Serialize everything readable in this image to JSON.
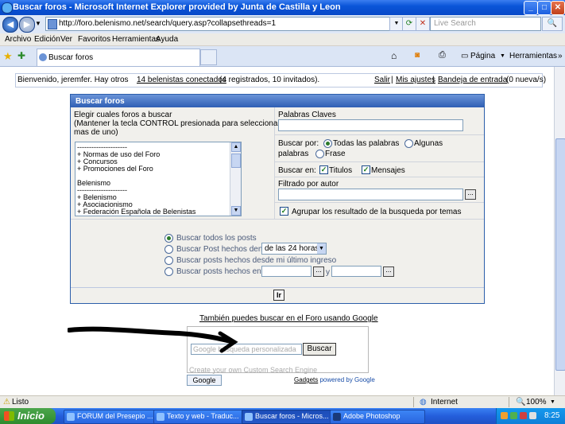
{
  "window": {
    "title": "Buscar foros - Microsoft Internet Explorer provided by Junta de Castilla y Leon",
    "controls": {
      "minimize": "_",
      "maximize": "□",
      "close": "✕"
    }
  },
  "addressbar": {
    "back_icon": "◀",
    "forward_icon": "▶",
    "url": "http://foro.belenismo.net/search/query.asp?collapsethreads=1",
    "refresh_icon": "⟳",
    "stop_icon": "✕",
    "search_placeholder": "Live Search",
    "search_icon": "🔍"
  },
  "menubar": {
    "items": [
      "Archivo",
      "Edición",
      "Ver",
      "Favoritos",
      "Herramientas",
      "Ayuda"
    ]
  },
  "tabbar": {
    "tab_label": "Buscar foros",
    "pagina_label": "Página",
    "herramientas_label": "Herramientas"
  },
  "welcome": {
    "prefix": "Bienvenido, jeremfer. Hay otros ",
    "link": "14 belenistas conectados",
    "suffix": " (4 registrados, 10 invitados).",
    "salir": "Salir",
    "sep1": "|",
    "ajustes": "Mis ajustes",
    "sep2": "|",
    "bandeja": "Bandeja de entrada",
    "bandeja_count": "(0 nueva/s)"
  },
  "panel": {
    "header": "Buscar foros",
    "choose_label_1": "Elegir cuales foros a buscar",
    "choose_label_2": "(Mantener la tecla CONTROL presionada para seleccionar",
    "choose_label_3": "mas de uno)",
    "forum_list": [
      "---------------------",
      "+ Normas de uso del Foro",
      "+ Concursos",
      "+ Promociones del Foro",
      "",
      "Belenismo",
      "---------------------",
      "+ Belenismo",
      "+ Asociacionismo",
      "+ Federación Española de Belenistas"
    ],
    "keywords_label": "Palabras Claves",
    "search_by_label": "Buscar por:",
    "all_words": "Todas las palabras",
    "some_words": "Algunas",
    "some_words_2": "palabras",
    "phrase": "Frase",
    "search_in_label": "Buscar en:",
    "titles": "Titulos",
    "messages": "Mensajes",
    "author_label": "Filtrado por autor",
    "group_label": "Agrupar los resultado de la busqueda por temas",
    "dots": "...",
    "opt_all": "Buscar todos los posts",
    "opt_within": "Buscar Post hechos dentro",
    "within_value": "de las 24 horas",
    "opt_since": "Buscar posts hechos desde mi último ingreso",
    "opt_between": "Buscar posts hechos entre",
    "and": "y",
    "go": "Ir"
  },
  "google": {
    "link": "También puedes buscar en el Foro usando Google",
    "input_watermark": "Google  búsqueda personalizada",
    "button": "Buscar",
    "cse_text": "Create your own Custom Search Engine",
    "badge": "Google",
    "gadgets": "Gadgets",
    "powered": " powered by Google"
  },
  "statusbar": {
    "status": "Listo",
    "zone": "Internet",
    "zoom": "100%"
  },
  "taskbar": {
    "start": "Inicio",
    "tasks": [
      {
        "label": "FORUM del Presepio ..."
      },
      {
        "label": "Texto y web - Traduc..."
      },
      {
        "label": "Buscar foros - Micros..."
      },
      {
        "label": "Adobe Photoshop"
      }
    ],
    "clock": "8:25"
  },
  "colors": {
    "titlebar": "#0a55d8",
    "panel_header": "#2f5fb4",
    "taskbar": "#245edb",
    "start": "#2e8b2e"
  }
}
